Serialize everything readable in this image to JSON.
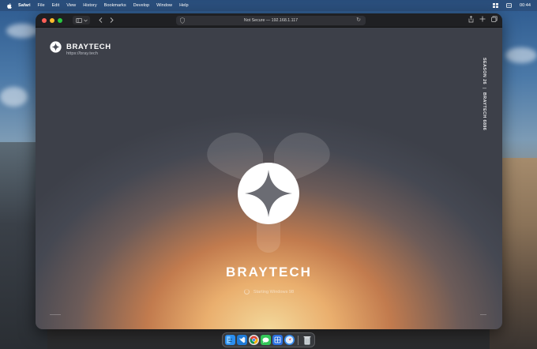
{
  "menubar": {
    "app_name": "Safari",
    "items": [
      "File",
      "Edit",
      "View",
      "History",
      "Bookmarks",
      "Develop",
      "Window",
      "Help"
    ],
    "clock": "00:44"
  },
  "browser": {
    "url_text": "Not Secure — 192.168.1.117"
  },
  "page": {
    "brand_name": "BRAYTECH",
    "brand_url": "https://bray.tech",
    "vertical_left": "SEASON 26",
    "vertical_right": "BRAYTECH 6896",
    "wordmark": "BRAYTECH",
    "status": "Starting Windows 98"
  },
  "dock": {
    "apps": [
      {
        "icon": "finder-icon",
        "color": "#2b8ff0"
      },
      {
        "icon": "vscode-icon",
        "color": "#1f7ad6"
      },
      {
        "icon": "chrome-icon",
        "color": "#e6e6e6"
      },
      {
        "icon": "messages-icon",
        "color": "#34c759"
      },
      {
        "icon": "app-store-icon",
        "color": "#2a6fe0"
      },
      {
        "icon": "safari-icon",
        "color": "#3b8dee"
      }
    ],
    "trash_icon": "trash-icon"
  },
  "colors": {
    "accent_glow": "#eaaf6e",
    "window_bg": "#454852"
  }
}
